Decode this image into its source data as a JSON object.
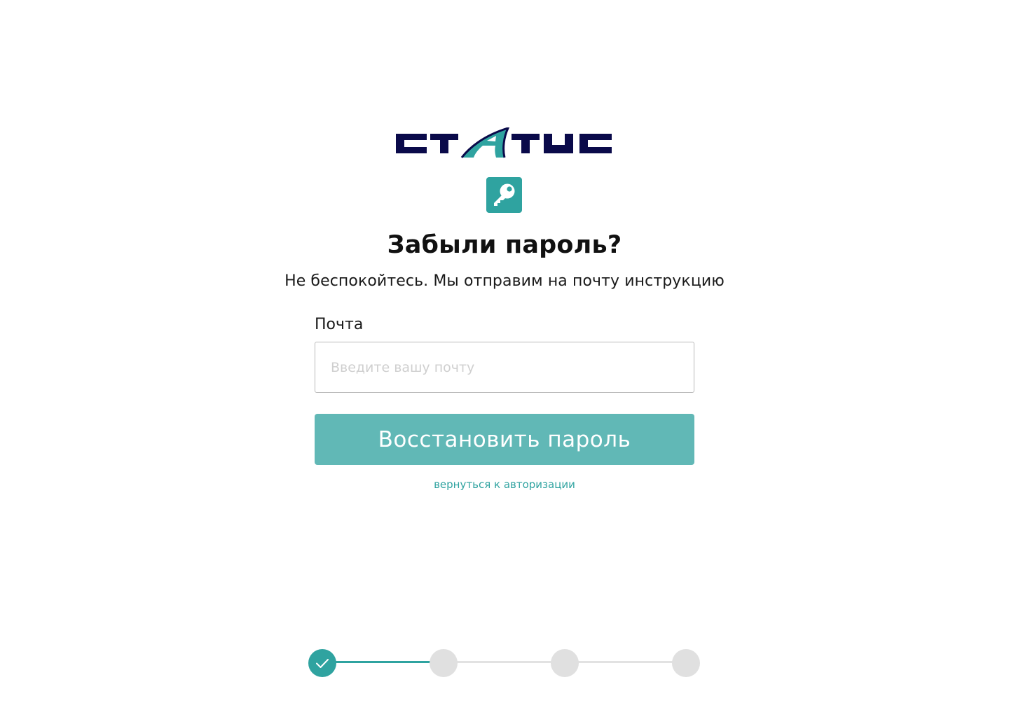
{
  "brand": {
    "logo_text": "СТАТУС",
    "colors": {
      "navy": "#0a0a4a",
      "teal": "#2fa3a0"
    }
  },
  "header": {
    "icon": "key-icon",
    "title": "Забыли пароль?",
    "subtitle": "Не беспокойтесь. Мы отправим на почту инструкцию"
  },
  "form": {
    "email_label": "Почта",
    "email_value": "",
    "email_placeholder": "Введите вашу почту",
    "submit_label": "Восстановить пароль",
    "back_link": "вернуться к авторизации"
  },
  "stepper": {
    "total_steps": 4,
    "current_step": 1,
    "completed_icon": "check-icon"
  },
  "colors": {
    "accent": "#2fa3a0",
    "button": "#61b8b6",
    "inactive": "#e0e0e0"
  }
}
